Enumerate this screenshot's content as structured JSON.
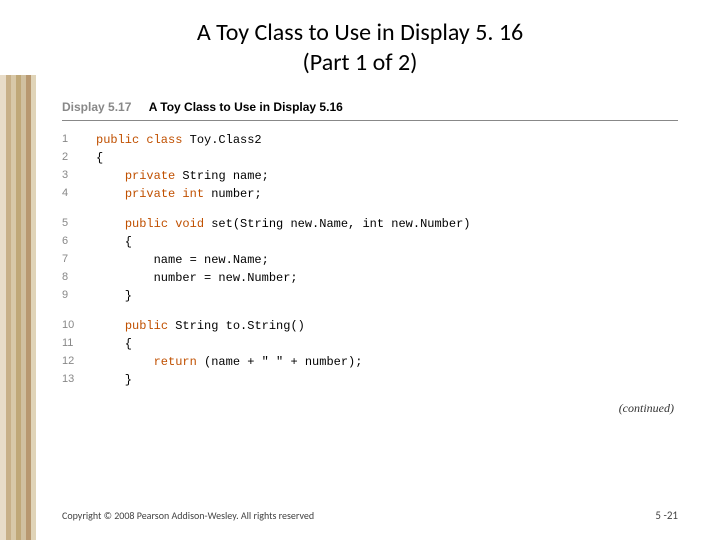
{
  "title_line1": "A Toy Class to Use in Display 5. 16",
  "title_line2": "(Part 1 of 2)",
  "display_num": "Display 5.17",
  "display_title": "A Toy Class to Use in Display 5.16",
  "blocks": [
    [
      {
        "n": "1",
        "pre": "",
        "kw": "public class",
        "post": " Toy.Class2"
      },
      {
        "n": "2",
        "pre": "{",
        "kw": "",
        "post": ""
      },
      {
        "n": "3",
        "pre": "    ",
        "kw": "private",
        "post": " String name;"
      },
      {
        "n": "4",
        "pre": "    ",
        "kw": "private int",
        "post": " number;"
      }
    ],
    [
      {
        "n": "5",
        "pre": "    ",
        "kw": "public void",
        "post": " set(String new.Name, int new.Number)"
      },
      {
        "n": "6",
        "pre": "    {",
        "kw": "",
        "post": ""
      },
      {
        "n": "7",
        "pre": "        name = new.Name;",
        "kw": "",
        "post": ""
      },
      {
        "n": "8",
        "pre": "        number = new.Number;",
        "kw": "",
        "post": ""
      },
      {
        "n": "9",
        "pre": "    }",
        "kw": "",
        "post": ""
      }
    ],
    [
      {
        "n": "10",
        "pre": "    ",
        "kw": "public",
        "post": " String to.String()"
      },
      {
        "n": "11",
        "pre": "    {",
        "kw": "",
        "post": ""
      },
      {
        "n": "12",
        "pre": "        ",
        "kw": "return",
        "post": " (name + \" \" + number);"
      },
      {
        "n": "13",
        "pre": "    }",
        "kw": "",
        "post": ""
      }
    ]
  ],
  "continued": "(continued)",
  "copyright": "Copyright © 2008 Pearson Addison-Wesley. All rights reserved",
  "page_num": "5 -21"
}
